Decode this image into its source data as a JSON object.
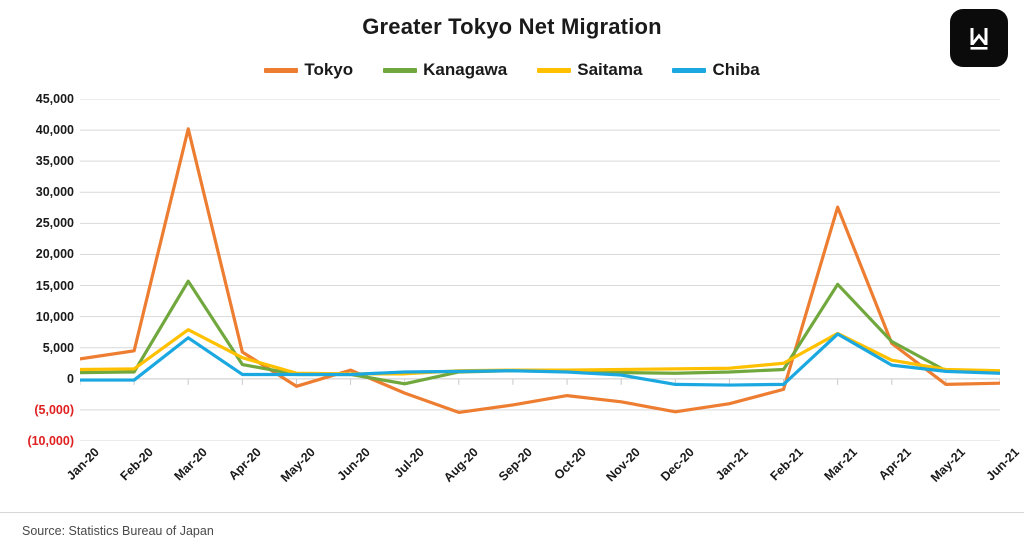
{
  "header": {
    "title": "Greater Tokyo Net Migration",
    "logo_alt": "logo-mark"
  },
  "footer": {
    "source": "Source: Statistics Bureau of Japan"
  },
  "chart_data": {
    "type": "line",
    "title": "Greater Tokyo Net Migration",
    "xlabel": "",
    "ylabel": "",
    "grid": true,
    "legend_position": "top",
    "ylim": [
      -10000,
      45000
    ],
    "ytick_step": 5000,
    "ytick_labels": [
      "45,000",
      "40,000",
      "35,000",
      "30,000",
      "25,000",
      "20,000",
      "15,000",
      "10,000",
      "5,000",
      "0",
      "(5,000)",
      "(10,000)"
    ],
    "ytick_values": [
      45000,
      40000,
      35000,
      30000,
      25000,
      20000,
      15000,
      10000,
      5000,
      0,
      -5000,
      -10000
    ],
    "negative_label_color": "#e02020",
    "categories": [
      "Jan-20",
      "Feb-20",
      "Mar-20",
      "Apr-20",
      "May-20",
      "Jun-20",
      "Jul-20",
      "Aug-20",
      "Sep-20",
      "Oct-20",
      "Nov-20",
      "Dec-20",
      "Jan-21",
      "Feb-21",
      "Mar-21",
      "Apr-21",
      "May-21",
      "Jun-21"
    ],
    "series": [
      {
        "name": "Tokyo",
        "color": "#ED7D31",
        "values": [
          3200,
          4500,
          40200,
          4300,
          -1200,
          1400,
          -2300,
          -5400,
          -4200,
          -2700,
          -3700,
          -5300,
          -4000,
          -1700,
          27600,
          5700,
          -900,
          -700
        ]
      },
      {
        "name": "Kanagawa",
        "color": "#71A83E",
        "values": [
          1000,
          1100,
          15700,
          2300,
          700,
          700,
          -800,
          1100,
          1300,
          1200,
          1000,
          900,
          1100,
          1500,
          15200,
          6000,
          1300,
          1200
        ]
      },
      {
        "name": "Saitama",
        "color": "#FFC000",
        "values": [
          1500,
          1600,
          7900,
          3400,
          900,
          800,
          800,
          1300,
          1400,
          1400,
          1500,
          1600,
          1700,
          2500,
          7300,
          3000,
          1500,
          1300
        ]
      },
      {
        "name": "Chiba",
        "color": "#1BA8E0",
        "values": [
          -200,
          -200,
          6600,
          700,
          700,
          700,
          1100,
          1200,
          1300,
          1100,
          600,
          -900,
          -1000,
          -900,
          7200,
          2200,
          1200,
          900
        ]
      }
    ]
  }
}
